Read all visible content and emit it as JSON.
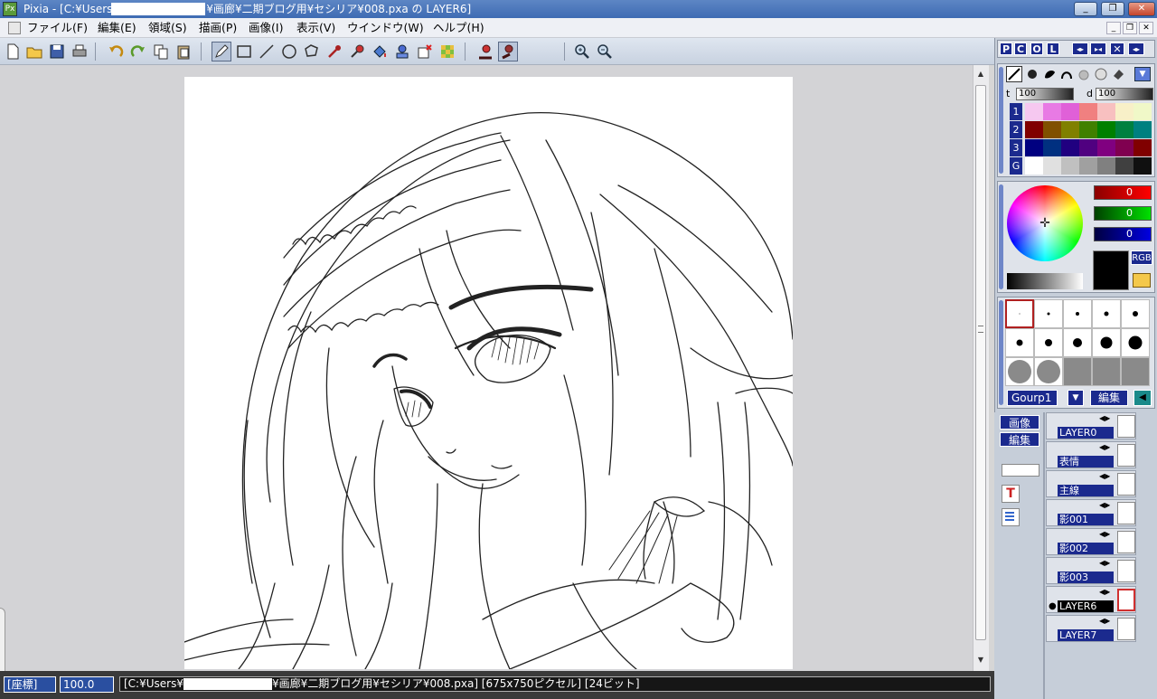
{
  "window": {
    "title": "Pixia - [C:¥Users¥        ¥画廊¥二期ブログ用¥セシリア¥008.pxa の LAYER6]",
    "title_prefix": "Pixia - [C:¥Users",
    "title_suffix": "¥画廊¥二期ブログ用¥セシリア¥008.pxa の LAYER6]",
    "icon_text": "Px",
    "minimize": "_",
    "maximize": "❐",
    "close": "✕"
  },
  "menu": {
    "items": [
      "ファイル(F)",
      "編集(E)",
      "領域(S)",
      "描画(P)",
      "画像(I)",
      "表示(V)",
      "ウインドウ(W)",
      "ヘルプ(H)"
    ],
    "mdi_minimize": "_",
    "mdi_restore": "❐",
    "mdi_close": "✕"
  },
  "toolbar": {
    "icons": [
      "new-file-icon",
      "open-folder-icon",
      "save-icon",
      "print-icon",
      "undo-icon",
      "redo-icon",
      "copy-icon",
      "paste-icon",
      "pen-tool-icon",
      "rectangle-tool-icon",
      "line-tool-icon",
      "ellipse-tool-icon",
      "lasso-tool-icon",
      "eyedropper-icon",
      "spray-icon",
      "bucket-fill-icon",
      "stamp-icon",
      "transform-icon",
      "mosaic-icon",
      "eraser-red-icon",
      "eraser-dark-icon",
      "zoom-in-icon",
      "zoom-out-icon"
    ],
    "current_color": "#000000"
  },
  "panel": {
    "tabs": [
      "P",
      "C",
      "O",
      "L"
    ],
    "tab_extra_icons": [
      "swap-horizontal-icon",
      "expand-horizontal-icon",
      "close-panel-icon",
      "collapse-panel-icon"
    ],
    "brush_opacity_label": "t",
    "brush_opacity": "100",
    "brush_density_label": "d",
    "brush_density": "100",
    "palette_rows": [
      {
        "label": "1",
        "colors": [
          "#f6c8f0",
          "#e87ae4",
          "#e060d8",
          "#f08080",
          "#f8c0c0",
          "#f8f0c8",
          "#f0f8c8"
        ]
      },
      {
        "label": "2",
        "colors": [
          "#800000",
          "#805000",
          "#808000",
          "#408000",
          "#008000",
          "#008040",
          "#008080"
        ]
      },
      {
        "label": "3",
        "colors": [
          "#000080",
          "#003080",
          "#200080",
          "#500080",
          "#800080",
          "#800050",
          "#800000"
        ]
      },
      {
        "label": "G",
        "colors": [
          "#ffffff",
          "#e0e0e0",
          "#c0c0c0",
          "#a0a0a0",
          "#808080",
          "#404040",
          "#101010"
        ]
      }
    ],
    "rgb": {
      "r": "0",
      "g": "0",
      "b": "0",
      "mode_label": "RGB"
    },
    "brush_group": "Gourp1",
    "brush_edit": "編集",
    "image_label": "画像",
    "edit_label": "編集",
    "layers": [
      {
        "name": "LAYER0",
        "active": false
      },
      {
        "name": "表情",
        "active": false
      },
      {
        "name": "主線",
        "active": false
      },
      {
        "name": "影001",
        "active": false
      },
      {
        "name": "影002",
        "active": false
      },
      {
        "name": "影003",
        "active": false
      },
      {
        "name": "LAYER6",
        "active": true
      },
      {
        "name": "LAYER7",
        "active": false
      }
    ]
  },
  "status": {
    "coords_label": "[座標]",
    "zoom": "100.0",
    "info_prefix": "[C:¥Users¥",
    "info_suffix": "¥画廊¥二期ブログ用¥セシリア¥008.pxa] [675x750ピクセル] [24ビット]"
  }
}
